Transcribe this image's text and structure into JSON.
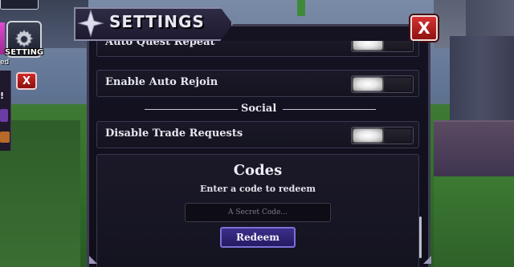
{
  "hud": {
    "setting_label": "SETTING",
    "side_text": "ed",
    "side_excl": "!",
    "close_small": "X"
  },
  "panel": {
    "title": "SETTINGS",
    "close_label": "X",
    "rows": [
      {
        "label": "Auto Quest Repeat",
        "state": "on"
      },
      {
        "label": "Enable Auto Rejoin",
        "state": "on"
      }
    ],
    "section_social": "Social",
    "social_rows": [
      {
        "label": "Disable Trade Requests",
        "state": "on"
      }
    ],
    "codes": {
      "title": "Codes",
      "subtitle": "Enter a code to redeem",
      "placeholder": "A Secret Code...",
      "redeem_label": "Redeem"
    }
  }
}
